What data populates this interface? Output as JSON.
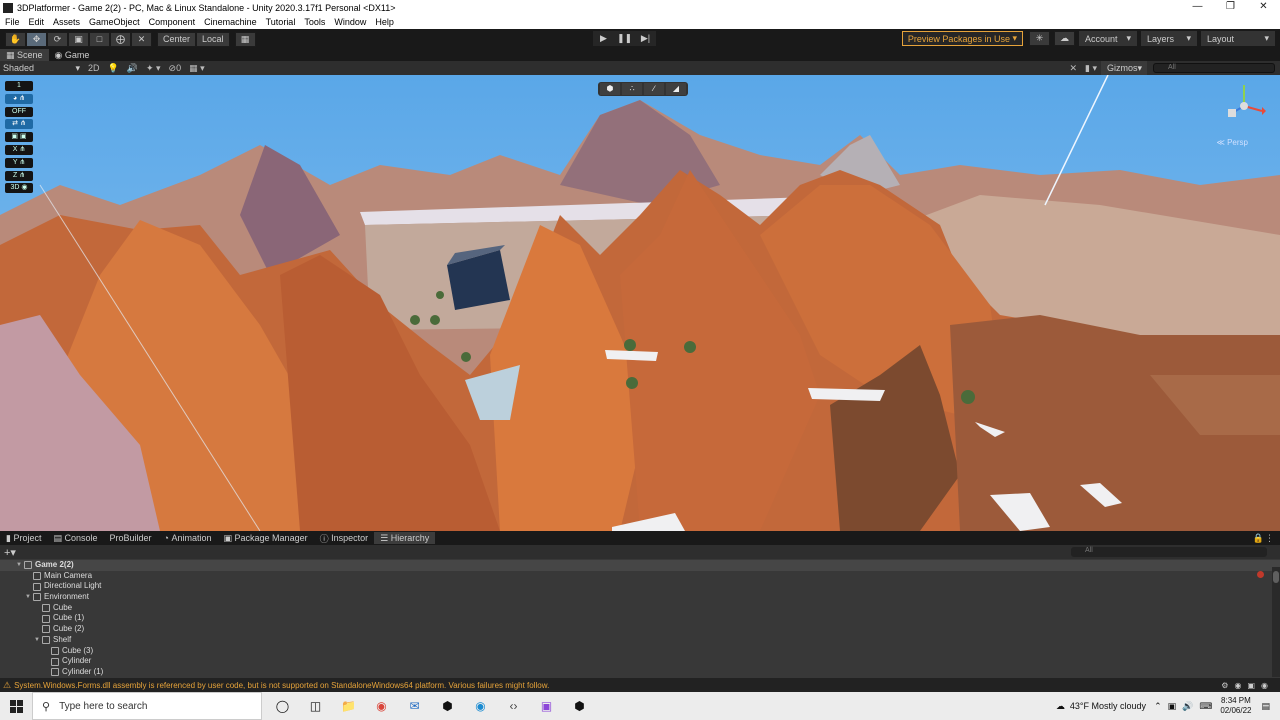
{
  "window": {
    "title": "3DPlatformer - Game 2(2) - PC, Mac & Linux Standalone - Unity 2020.3.17f1 Personal <DX11>"
  },
  "menu": [
    "File",
    "Edit",
    "Assets",
    "GameObject",
    "Component",
    "Cinemachine",
    "Tutorial",
    "Tools",
    "Window",
    "Help"
  ],
  "toolbar": {
    "pivot": "Center",
    "space": "Local",
    "preview_packages": "Preview Packages in Use",
    "account": "Account",
    "layers": "Layers",
    "layout": "Layout"
  },
  "tabs": {
    "scene": "Scene",
    "game": "Game"
  },
  "scene": {
    "shading": "Shaded",
    "mode_2d": "2D",
    "fx_count": "0",
    "gizmos": "Gizmos",
    "search_placeholder": "All",
    "perspective": "≪ Persp",
    "overlay": [
      "1",
      "◕ ⋔",
      "OFF",
      "⇄ ⋔",
      "▣ ▣",
      "X ⋔",
      "Y ⋔",
      "Z ⋔",
      "3D ◉"
    ]
  },
  "bottom_tabs": [
    "Project",
    "Console",
    "ProBuilder",
    "Animation",
    "Package Manager",
    "Inspector",
    "Hierarchy"
  ],
  "hierarchy": {
    "search_placeholder": "All",
    "items": [
      {
        "label": "Game 2(2)",
        "depth": 0,
        "root": true,
        "expanded": true
      },
      {
        "label": "Main Camera",
        "depth": 1
      },
      {
        "label": "Directional Light",
        "depth": 1
      },
      {
        "label": "Environment",
        "depth": 1,
        "expanded": true
      },
      {
        "label": "Cube",
        "depth": 2
      },
      {
        "label": "Cube (1)",
        "depth": 2
      },
      {
        "label": "Cube (2)",
        "depth": 2
      },
      {
        "label": "Shelf",
        "depth": 2,
        "expanded": true
      },
      {
        "label": "Cube (3)",
        "depth": 3
      },
      {
        "label": "Cylinder",
        "depth": 3
      },
      {
        "label": "Cylinder (1)",
        "depth": 3
      }
    ]
  },
  "status": {
    "message": "System.Windows.Forms.dll assembly is referenced by user code, but is not supported on StandaloneWindows64 platform. Various failures might follow."
  },
  "taskbar": {
    "search_placeholder": "Type here to search",
    "weather": "43°F  Mostly cloudy",
    "time": "8:34 PM",
    "date": "02/06/22"
  }
}
